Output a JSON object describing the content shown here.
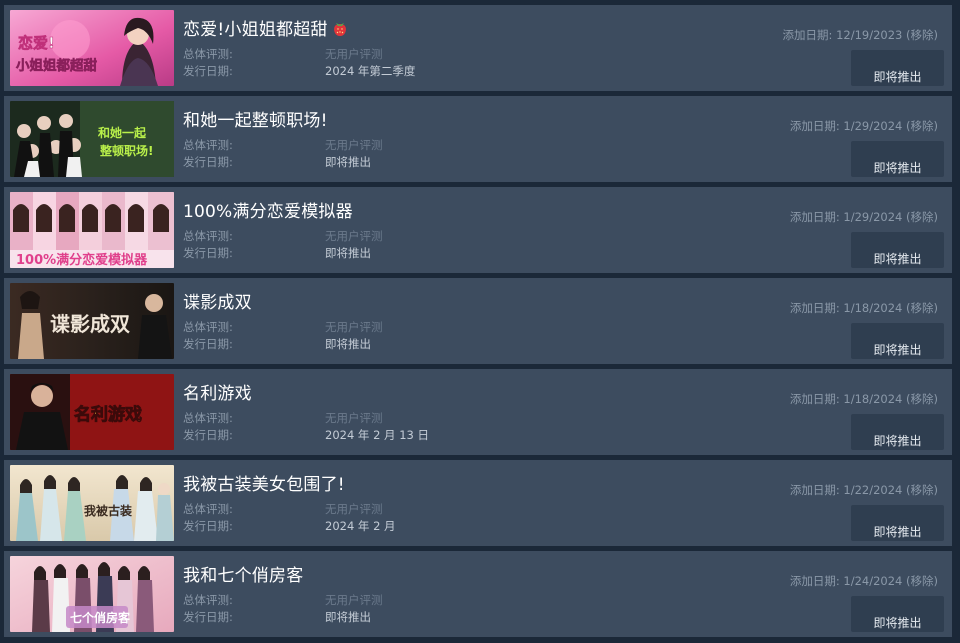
{
  "labels": {
    "review": "总体评测:",
    "release": "发行日期:",
    "added_prefix": "添加日期:",
    "remove": "(移除)"
  },
  "items": [
    {
      "title": "恋爱!小姐姐都超甜",
      "title_icon": "strawberry-icon",
      "thumb_text": "恋爱!小姐姐都超甜",
      "review": "无用户评测",
      "release": "2024 年第二季度",
      "added_date": "12/19/2023",
      "button": "即将推出"
    },
    {
      "title": "和她一起整顿职场!",
      "thumb_text": "和她一起整顿职场!",
      "review": "无用户评测",
      "release": "即将推出",
      "added_date": "1/29/2024",
      "button": "即将推出"
    },
    {
      "title": "100%满分恋爱模拟器",
      "thumb_text": "100%满分恋爱模拟器",
      "review": "无用户评测",
      "release": "即将推出",
      "added_date": "1/29/2024",
      "button": "即将推出"
    },
    {
      "title": "谍影成双",
      "thumb_text": "谍影成双",
      "review": "无用户评测",
      "release": "即将推出",
      "added_date": "1/18/2024",
      "button": "即将推出"
    },
    {
      "title": "名利游戏",
      "thumb_text": "名利游戏",
      "review": "无用户评测",
      "release": "2024 年 2 月 13 日",
      "added_date": "1/18/2024",
      "button": "即将推出"
    },
    {
      "title": "我被古装美女包围了!",
      "thumb_text": "我被古装美女包围了!",
      "review": "无用户评测",
      "release": "2024 年 2 月",
      "added_date": "1/22/2024",
      "button": "即将推出"
    },
    {
      "title": "我和七个俏房客",
      "thumb_text": "我和七个俏房客",
      "review": "无用户评测",
      "release": "即将推出",
      "added_date": "1/24/2024",
      "button": "即将推出"
    }
  ],
  "colors": {
    "page_bg": "#1b2838",
    "row_bg": "#3d4c5f",
    "button_bg": "#2f3e50",
    "title": "#ffffff",
    "label": "#8a98a8"
  }
}
